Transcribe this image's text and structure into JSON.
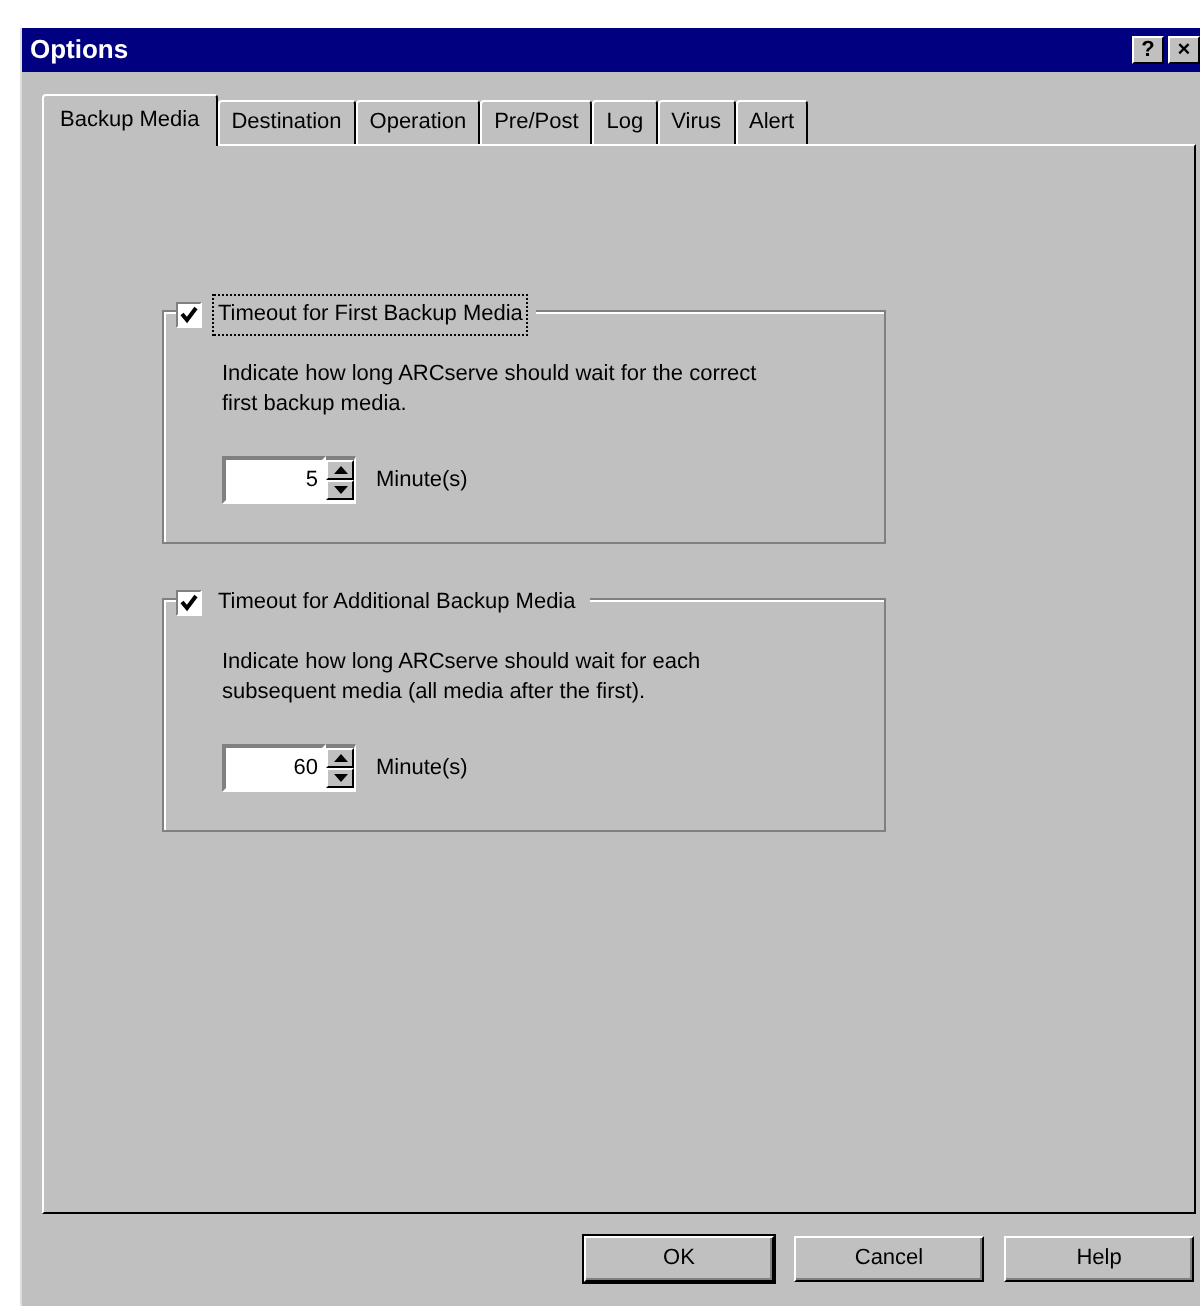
{
  "window": {
    "title": "Options",
    "title_buttons": [
      "?",
      "×"
    ]
  },
  "tabs": [
    {
      "label": "Backup Media",
      "selected": true
    },
    {
      "label": "Destination",
      "selected": false
    },
    {
      "label": "Operation",
      "selected": false
    },
    {
      "label": "Pre/Post",
      "selected": false
    },
    {
      "label": "Log",
      "selected": false
    },
    {
      "label": "Virus",
      "selected": false
    },
    {
      "label": "Alert",
      "selected": false
    }
  ],
  "groups": [
    {
      "label": "Timeout for First Backup Media",
      "checked": true,
      "focused": true,
      "description": "Indicate how long ARCserve should wait for the correct first backup media.",
      "value": "5",
      "unit": "Minute(s)"
    },
    {
      "label": "Timeout for Additional Backup Media",
      "checked": true,
      "focused": false,
      "description": "Indicate how long ARCserve should wait for each subsequent media (all media after the first).",
      "value": "60",
      "unit": "Minute(s)"
    }
  ],
  "buttons": [
    "OK",
    "Cancel",
    "Help"
  ]
}
